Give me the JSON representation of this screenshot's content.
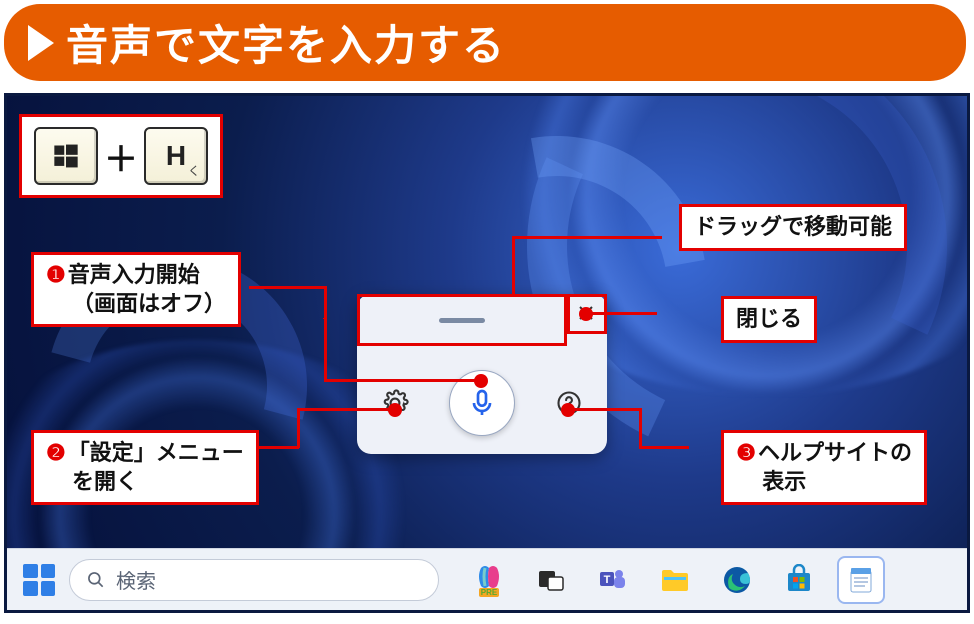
{
  "banner": {
    "title": "音声で文字を入力する"
  },
  "shortcut": {
    "key1_label": "winlogo",
    "plus": "＋",
    "key2_label": "H",
    "key2_sub": "く"
  },
  "annotations": {
    "drag": "ドラッグで移動可能",
    "close": "閉じる",
    "a1_num": "❶",
    "a1_l1": "音声入力開始",
    "a1_l2": "（画面はオフ）",
    "a2_num": "❷",
    "a2_l1": "「設定」メニュー",
    "a2_l2": "を開く",
    "a3_num": "❸",
    "a3_l1": "ヘルプサイトの",
    "a3_l2": "表示"
  },
  "taskbar": {
    "search_placeholder": "検索",
    "copilot_badge": "PRE"
  }
}
